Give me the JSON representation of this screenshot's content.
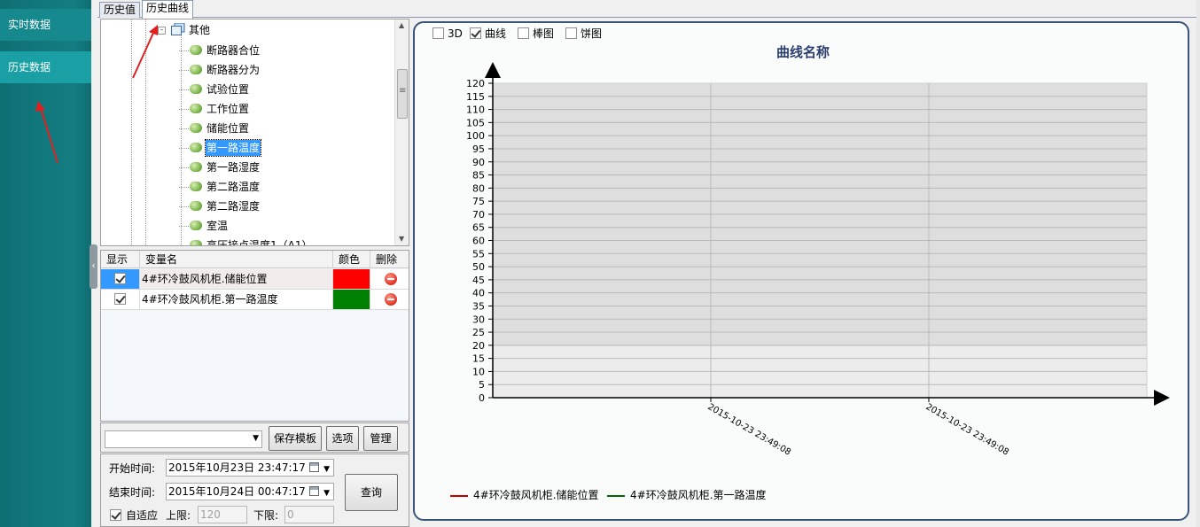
{
  "nav": {
    "items": [
      {
        "label": "实时数据"
      },
      {
        "label": "历史数据"
      }
    ],
    "collapse_glyph": "‹"
  },
  "tabs": [
    {
      "label": "历史值",
      "active": false
    },
    {
      "label": "历史曲线",
      "active": true
    }
  ],
  "tree": {
    "folder_label": "其他",
    "nodes": [
      {
        "label": "断路器合位",
        "selected": false
      },
      {
        "label": "断路器分为",
        "selected": false
      },
      {
        "label": "试验位置",
        "selected": false
      },
      {
        "label": "工作位置",
        "selected": false
      },
      {
        "label": "储能位置",
        "selected": false
      },
      {
        "label": "第一路温度",
        "selected": true
      },
      {
        "label": "第一路湿度",
        "selected": false
      },
      {
        "label": "第二路温度",
        "selected": false
      },
      {
        "label": "第二路湿度",
        "selected": false
      },
      {
        "label": "室温",
        "selected": false
      },
      {
        "label": "高压接点温度1（A1）",
        "selected": false
      }
    ],
    "scroll_grip": "≡"
  },
  "grid": {
    "headers": {
      "show": "显示",
      "name": "变量名",
      "color": "颜色",
      "delete": "删除"
    },
    "rows": [
      {
        "show": true,
        "name": "4#环冷鼓风机柜.储能位置",
        "color": "#ff0000"
      },
      {
        "show": true,
        "name": "4#环冷鼓风机柜.第一路温度",
        "color": "#008000"
      }
    ]
  },
  "template": {
    "combo_value": "",
    "save_label": "保存模板",
    "options_label": "选项",
    "manage_label": "管理"
  },
  "time": {
    "start_label": "开始时间:",
    "start_value": "2015年10月23日  23:47:17",
    "end_label": "结束时间:",
    "end_value": "2015年10月24日  00:47:17",
    "auto_label": "自适应",
    "auto_checked": true,
    "upper_label": "上限:",
    "upper_value": "120",
    "lower_label": "下限:",
    "lower_value": "0",
    "query_label": "查询"
  },
  "chart_options": [
    {
      "label": "3D",
      "checked": false
    },
    {
      "label": "曲线",
      "checked": true
    },
    {
      "label": "棒图",
      "checked": false
    },
    {
      "label": "饼图",
      "checked": false
    }
  ],
  "chart_data": {
    "type": "line",
    "title": "曲线名称",
    "ylim": [
      0,
      120
    ],
    "y_ticks": [
      0,
      5,
      10,
      15,
      20,
      25,
      30,
      35,
      40,
      45,
      50,
      55,
      60,
      65,
      70,
      75,
      80,
      85,
      90,
      95,
      100,
      105,
      110,
      115,
      120
    ],
    "x_ticks": [
      "2015-10-23 23:49:08",
      "2015-10-23 23:49:08"
    ],
    "grid": true,
    "legend_position": "bottom-left",
    "series": [
      {
        "name": "4#环冷鼓风机柜.储能位置",
        "color": "#cc0000",
        "values": []
      },
      {
        "name": "4#环冷鼓风机柜.第一路温度",
        "color": "#006400",
        "values": []
      }
    ]
  }
}
